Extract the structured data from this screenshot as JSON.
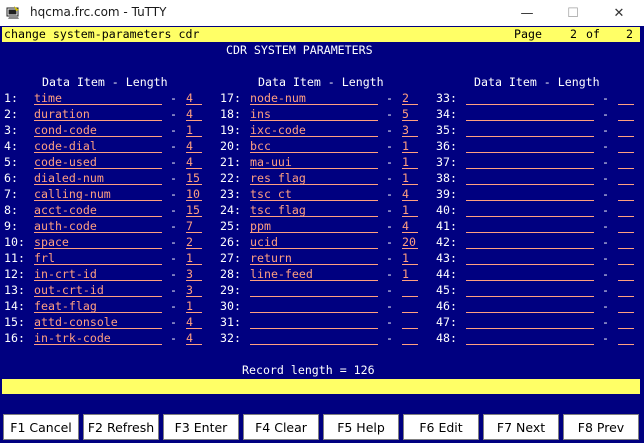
{
  "window": {
    "title": "hqcma.frc.com - TuTTY",
    "minimize_glyph": "—",
    "maximize_glyph": "☐",
    "close_glyph": "✕"
  },
  "command": {
    "text": "change system-parameters cdr",
    "page_label": "Page",
    "page_current": "2",
    "page_of": "of",
    "page_total": "2"
  },
  "form": {
    "title": "CDR SYSTEM PARAMETERS",
    "column_header": "Data Item - Length",
    "rows": [
      {
        "n": "1",
        "item": "time",
        "length": "4"
      },
      {
        "n": "2",
        "item": "duration",
        "length": "4"
      },
      {
        "n": "3",
        "item": "cond-code",
        "length": "1"
      },
      {
        "n": "4",
        "item": "code-dial",
        "length": "4"
      },
      {
        "n": "5",
        "item": "code-used",
        "length": "4"
      },
      {
        "n": "6",
        "item": "dialed-num",
        "length": "15"
      },
      {
        "n": "7",
        "item": "calling-num",
        "length": "10"
      },
      {
        "n": "8",
        "item": "acct-code",
        "length": "15"
      },
      {
        "n": "9",
        "item": "auth-code",
        "length": "7"
      },
      {
        "n": "10",
        "item": "space",
        "length": "2"
      },
      {
        "n": "11",
        "item": "frl",
        "length": "1"
      },
      {
        "n": "12",
        "item": "in-crt-id",
        "length": "3"
      },
      {
        "n": "13",
        "item": "out-crt-id",
        "length": "3"
      },
      {
        "n": "14",
        "item": "feat-flag",
        "length": "1"
      },
      {
        "n": "15",
        "item": "attd-console",
        "length": "4"
      },
      {
        "n": "16",
        "item": "in-trk-code",
        "length": "4"
      },
      {
        "n": "17",
        "item": "node-num",
        "length": "2"
      },
      {
        "n": "18",
        "item": "ins",
        "length": "5"
      },
      {
        "n": "19",
        "item": "ixc-code",
        "length": "3"
      },
      {
        "n": "20",
        "item": "bcc",
        "length": "1"
      },
      {
        "n": "21",
        "item": "ma-uui",
        "length": "1"
      },
      {
        "n": "22",
        "item": "res flag",
        "length": "1"
      },
      {
        "n": "23",
        "item": "tsc ct",
        "length": "4"
      },
      {
        "n": "24",
        "item": "tsc flag",
        "length": "1"
      },
      {
        "n": "25",
        "item": "ppm",
        "length": "4"
      },
      {
        "n": "26",
        "item": "ucid",
        "length": "20"
      },
      {
        "n": "27",
        "item": "return",
        "length": "1"
      },
      {
        "n": "28",
        "item": "line-feed",
        "length": "1"
      },
      {
        "n": "29",
        "item": "",
        "length": ""
      },
      {
        "n": "30",
        "item": "",
        "length": ""
      },
      {
        "n": "31",
        "item": "",
        "length": ""
      },
      {
        "n": "32",
        "item": "",
        "length": ""
      },
      {
        "n": "33",
        "item": "",
        "length": ""
      },
      {
        "n": "34",
        "item": "",
        "length": ""
      },
      {
        "n": "35",
        "item": "",
        "length": ""
      },
      {
        "n": "36",
        "item": "",
        "length": ""
      },
      {
        "n": "37",
        "item": "",
        "length": ""
      },
      {
        "n": "38",
        "item": "",
        "length": ""
      },
      {
        "n": "39",
        "item": "",
        "length": ""
      },
      {
        "n": "40",
        "item": "",
        "length": ""
      },
      {
        "n": "41",
        "item": "",
        "length": ""
      },
      {
        "n": "42",
        "item": "",
        "length": ""
      },
      {
        "n": "43",
        "item": "",
        "length": ""
      },
      {
        "n": "44",
        "item": "",
        "length": ""
      },
      {
        "n": "45",
        "item": "",
        "length": ""
      },
      {
        "n": "46",
        "item": "",
        "length": ""
      },
      {
        "n": "47",
        "item": "",
        "length": ""
      },
      {
        "n": "48",
        "item": "",
        "length": ""
      }
    ],
    "record_length": "Record length = 126"
  },
  "function_keys": [
    "F1 Cancel",
    "F2 Refresh",
    "F3 Enter",
    "F4 Clear",
    "F5 Help",
    "F6 Edit",
    "F7 Next",
    "F8 Prev"
  ],
  "colors": {
    "background": "#000080",
    "text": "#ffffff",
    "field": "#ff9f80",
    "bar": "#ffff66"
  }
}
